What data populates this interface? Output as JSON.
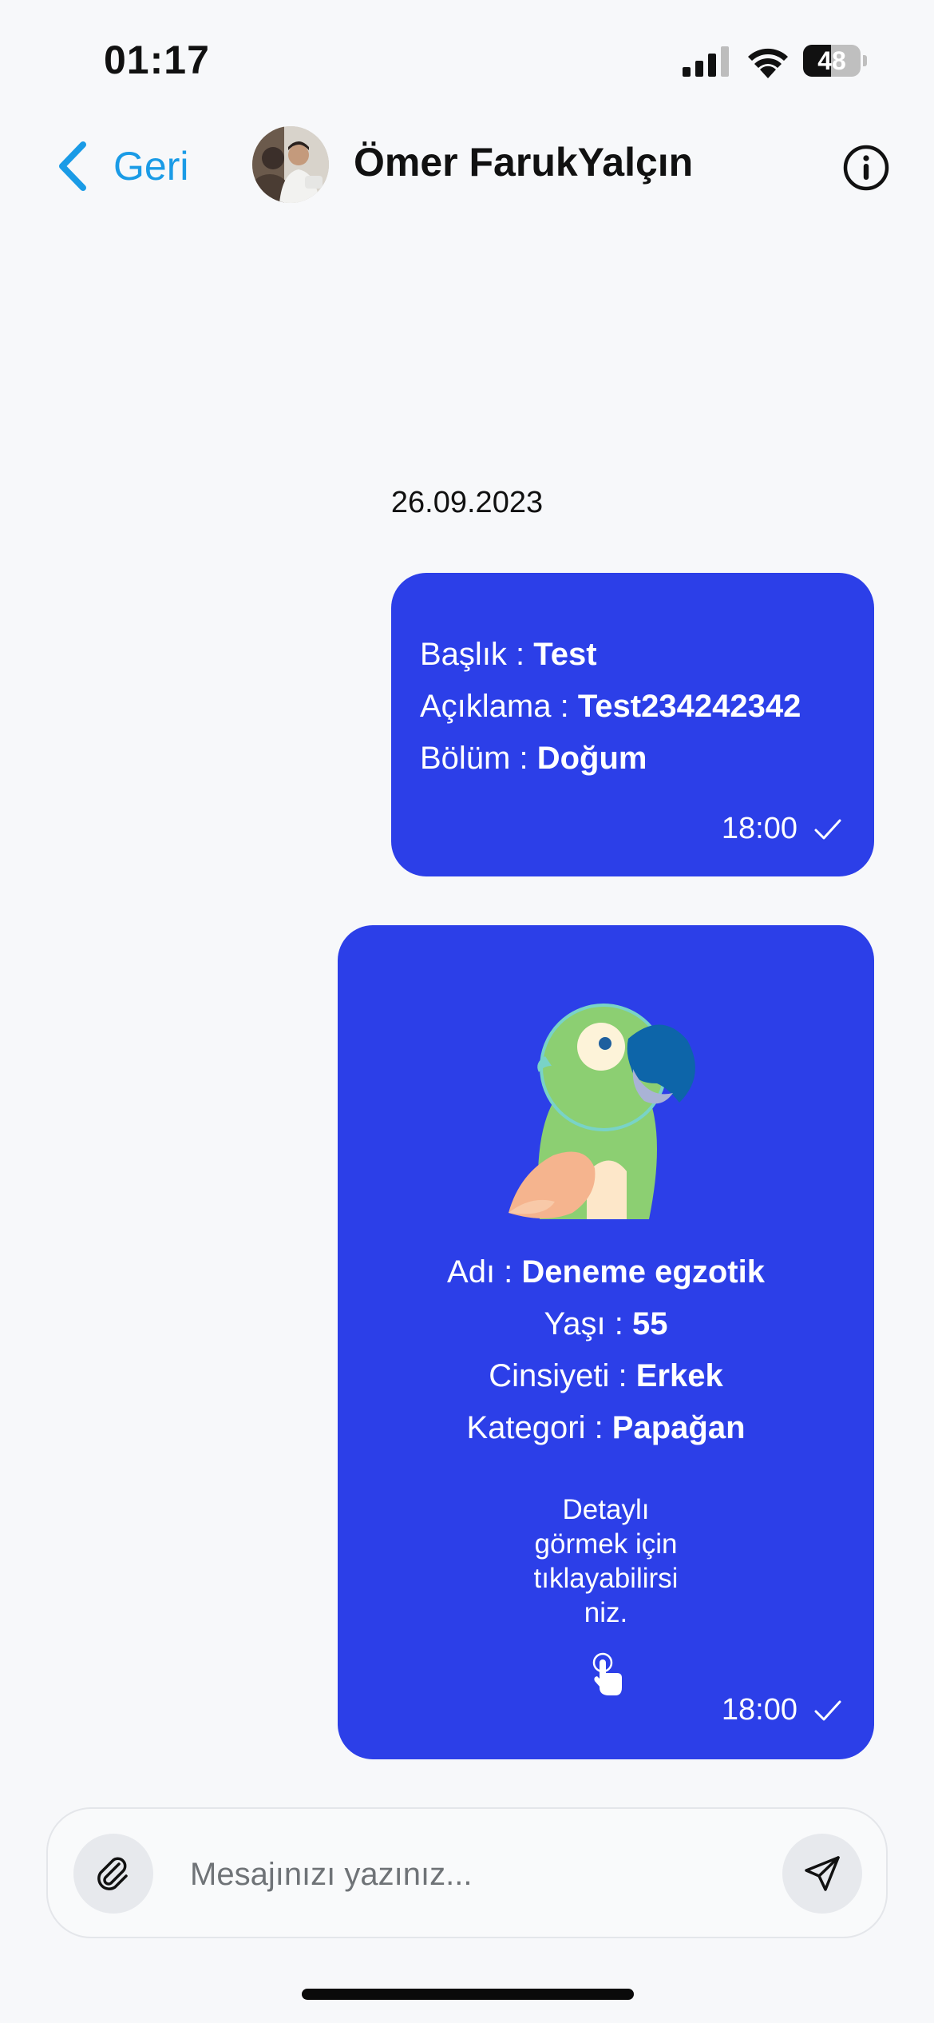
{
  "status_bar": {
    "time": "01:17",
    "battery_level": "48",
    "battery_fraction": 0.48,
    "icons": [
      "cellular-signal-icon",
      "wifi-icon",
      "battery-icon"
    ]
  },
  "nav": {
    "back_label": "Geri",
    "contact_name": "Ömer FarukYalçın",
    "icons": [
      "chevron-left-icon",
      "info-icon"
    ]
  },
  "chat": {
    "date": "26.09.2023",
    "message_1": {
      "title_label": "Başlık : ",
      "title_value": "Test",
      "description_label": "Açıklama : ",
      "description_value": "Test234242342",
      "department_label": "Bölüm : ",
      "department_value": "Doğum",
      "time": "18:00"
    },
    "message_2": {
      "name_label": "Adı : ",
      "name_value": "Deneme egzotik",
      "age_label": "Yaşı : ",
      "age_value": "55",
      "gender_label": "Cinsiyeti : ",
      "gender_value": "Erkek",
      "category_label": "Kategori : ",
      "category_value": "Papağan",
      "detail_line_1": "Detaylı",
      "detail_line_2": "görmek için",
      "detail_line_3": "tıklayabilirsi",
      "detail_line_4": "niz.",
      "time": "18:00"
    }
  },
  "composer": {
    "placeholder": "Mesajınızı yazınız...",
    "icons": [
      "paperclip-icon",
      "send-icon"
    ]
  },
  "colors": {
    "bubble": "#2c3fe8",
    "accent": "#1a9be6",
    "background": "#f7f8fa"
  }
}
